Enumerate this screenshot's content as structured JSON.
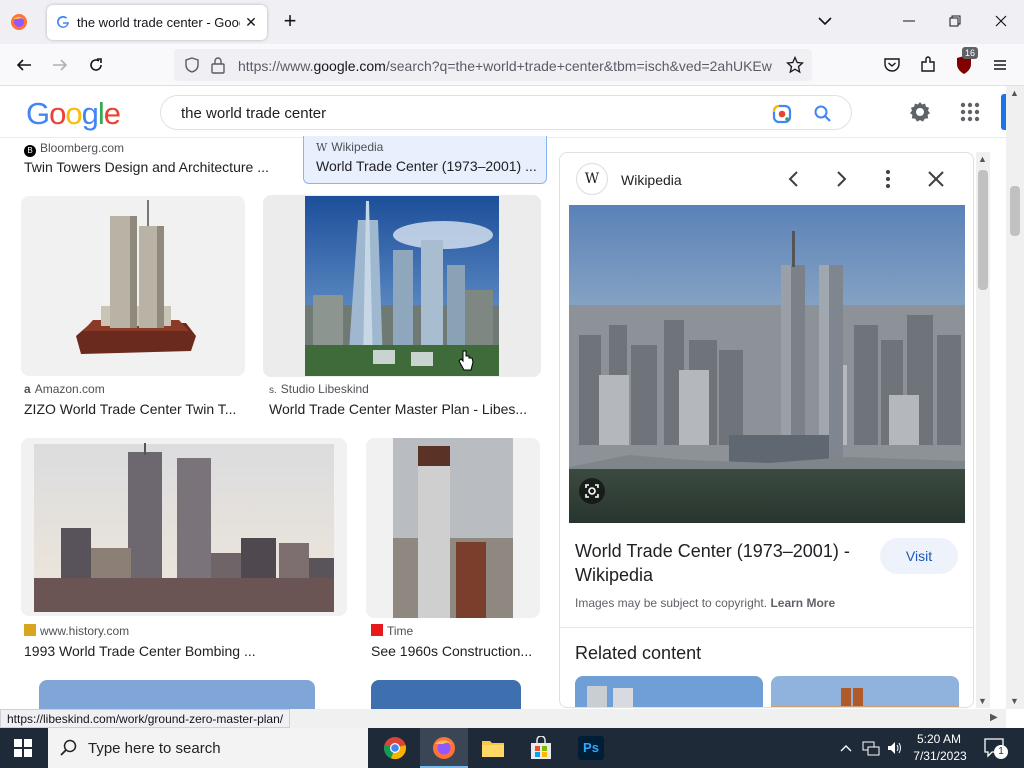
{
  "browser": {
    "tab_title": "the world trade center - Google Search",
    "url_prefix": "https://www.",
    "url_domain": "google.com",
    "url_rest": "/search?q=the+world+trade+center&tbm=isch&ved=2ahUKEw",
    "extension_badge": "16",
    "status_url": "https://libeskind.com/work/ground-zero-master-plan/"
  },
  "google": {
    "logo": "Google",
    "query": "the world trade center"
  },
  "results": {
    "row0": [
      {
        "source": "Bloomberg.com",
        "caption": "Twin Towers Design and Architecture ..."
      },
      {
        "source": "Wikipedia",
        "caption": "World Trade Center (1973–2001) ..."
      }
    ],
    "row1": [
      {
        "source": "Amazon.com",
        "caption": "ZIZO World Trade Center Twin T..."
      },
      {
        "source": "Studio Libeskind",
        "caption": "World Trade Center Master Plan - Libes..."
      }
    ],
    "row2": [
      {
        "source": "www.history.com",
        "caption": "1993 World Trade Center Bombing ..."
      },
      {
        "source": "Time",
        "caption": "See 1960s Construction..."
      }
    ]
  },
  "panel": {
    "source": "Wikipedia",
    "title": "World Trade Center (1973–2001) - Wikipedia",
    "visit_label": "Visit",
    "copyright": "Images may be subject to copyright.",
    "learn_more": "Learn More",
    "related_heading": "Related content"
  },
  "taskbar": {
    "search_placeholder": "Type here to search",
    "time": "5:20 AM",
    "date": "7/31/2023",
    "notification_count": "1"
  }
}
